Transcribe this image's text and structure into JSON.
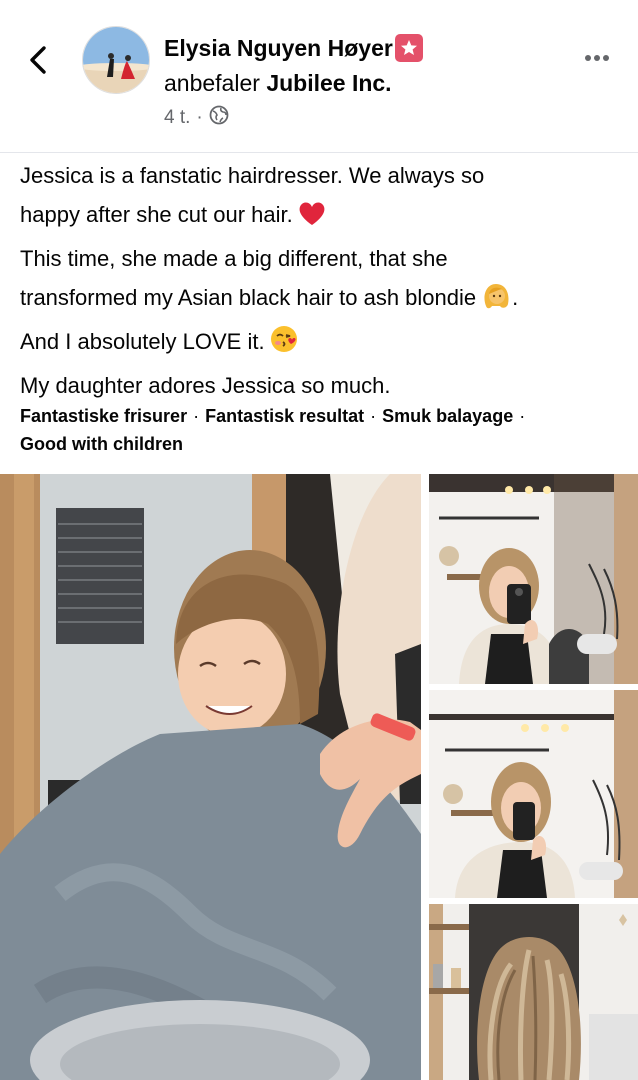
{
  "header": {
    "author": "Elysia Nguyen Høyer",
    "action": "anbefaler",
    "page": "Jubilee Inc.",
    "time": "4 t.",
    "separator": "·"
  },
  "post": {
    "lines": [
      "Jessica is a fanstatic hairdresser. We always so",
      "happy after she cut our hair.",
      "This time, she made a big different, that she",
      "transformed my Asian black hair to ash blondie",
      "And I absolutely LOVE it.",
      "My daughter adores Jessica so much."
    ],
    "trailing_period": ".",
    "emojis": [
      "heart-emoji",
      "blonde-person-emoji",
      "face-blowing-kiss-emoji"
    ]
  },
  "tags": {
    "items": [
      "Fantastiske frisurer",
      "Fantastisk resultat",
      "Smuk balayage",
      "Good with children"
    ],
    "separator": "·"
  },
  "photos": [
    {
      "name": "child-haircut-photo"
    },
    {
      "name": "mirror-selfie-photo-1"
    },
    {
      "name": "mirror-selfie-photo-2"
    },
    {
      "name": "hair-color-photo"
    }
  ],
  "colors": {
    "badge": "#e4516a",
    "meta_gray": "#65676b",
    "text": "#050505"
  }
}
